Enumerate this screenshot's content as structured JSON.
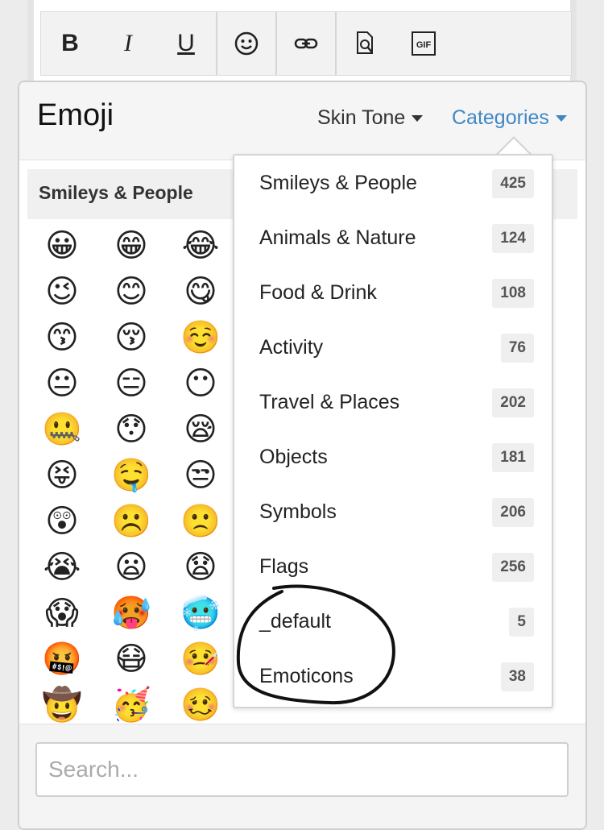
{
  "toolbar": {
    "buttons": [
      {
        "name": "bold-button",
        "label": "B"
      },
      {
        "name": "italic-button",
        "label": "I"
      },
      {
        "name": "underline-button",
        "label": "U"
      },
      {
        "name": "emoji-button",
        "label": "☺"
      },
      {
        "name": "link-button",
        "label": "🔗"
      },
      {
        "name": "preview-button",
        "label": "🔍"
      },
      {
        "name": "gif-button",
        "label": "GIF"
      }
    ]
  },
  "panel": {
    "title": "Emoji",
    "skin_tone_label": "Skin Tone",
    "categories_label": "Categories",
    "section_title": "Smileys & People"
  },
  "emoji_rows": [
    [
      "😀",
      "😁",
      "😂"
    ],
    [
      "😉",
      "😊",
      "😋"
    ],
    [
      "😙",
      "😚",
      "☺️"
    ],
    [
      "😐",
      "😑",
      "😶"
    ],
    [
      "🤐",
      "😯",
      "😪"
    ],
    [
      "😝",
      "🤤",
      "😒"
    ],
    [
      "😲",
      "☹️",
      "🙁"
    ],
    [
      "😭",
      "😦",
      "😧"
    ],
    [
      "😱",
      "🥵",
      "🥶"
    ],
    [
      "🤬",
      "😷",
      "🤒"
    ],
    [
      "🤠",
      "🥳",
      "🥴"
    ]
  ],
  "categories": [
    {
      "label": "Smileys & People",
      "count": "425"
    },
    {
      "label": "Animals & Nature",
      "count": "124"
    },
    {
      "label": "Food & Drink",
      "count": "108"
    },
    {
      "label": "Activity",
      "count": "76"
    },
    {
      "label": "Travel & Places",
      "count": "202"
    },
    {
      "label": "Objects",
      "count": "181"
    },
    {
      "label": "Symbols",
      "count": "206"
    },
    {
      "label": "Flags",
      "count": "256"
    },
    {
      "label": "_default",
      "count": "5"
    },
    {
      "label": "Emoticons",
      "count": "38"
    }
  ],
  "search": {
    "placeholder": "Search..."
  },
  "colors": {
    "accent": "#3f88c5"
  }
}
